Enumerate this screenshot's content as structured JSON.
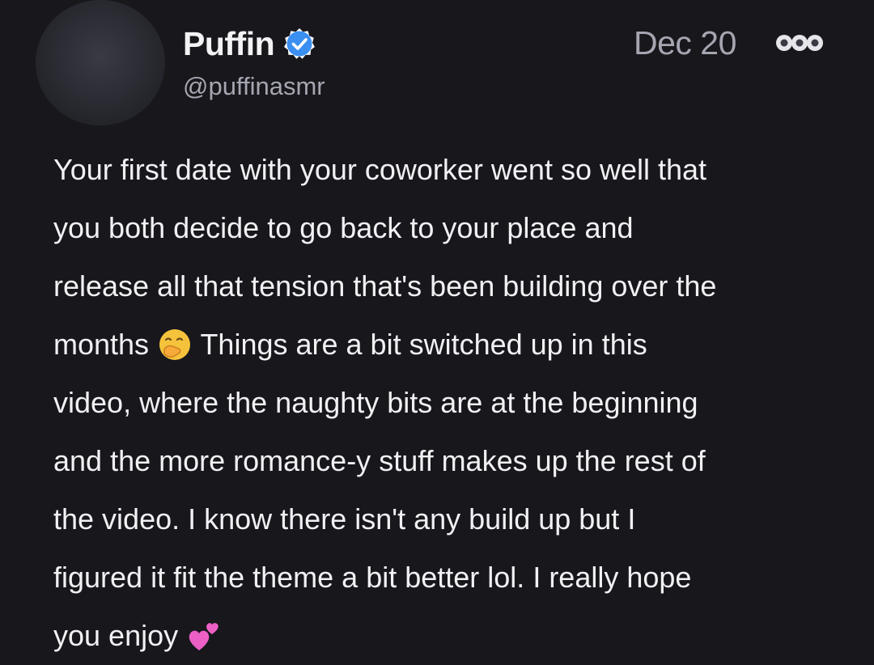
{
  "post": {
    "author": {
      "display_name": "Puffin",
      "handle": "@puffinasmr",
      "verified": true,
      "verified_color": "#3b8ff0"
    },
    "date": "Dec 20",
    "more_icon": "more-dots-icon",
    "body": {
      "line1": "Your first date with your coworker went so well that",
      "line2": "you both decide to go back to your place and",
      "line3": "release all that tension that's been building over the",
      "line4_a": "months",
      "line4_emoji": "face-with-hand-over-mouth-emoji",
      "line4_b": "Things are a bit switched up in this",
      "line5": "video, where the naughty bits are at the beginning",
      "line6": "and the more romance-y stuff makes up the rest of",
      "line7": "the video. I know there isn't any build up but I",
      "line8": "figured it fit the theme a bit better lol. I really hope",
      "line9_a": "you enjoy",
      "line9_emoji": "two-hearts-emoji"
    }
  }
}
